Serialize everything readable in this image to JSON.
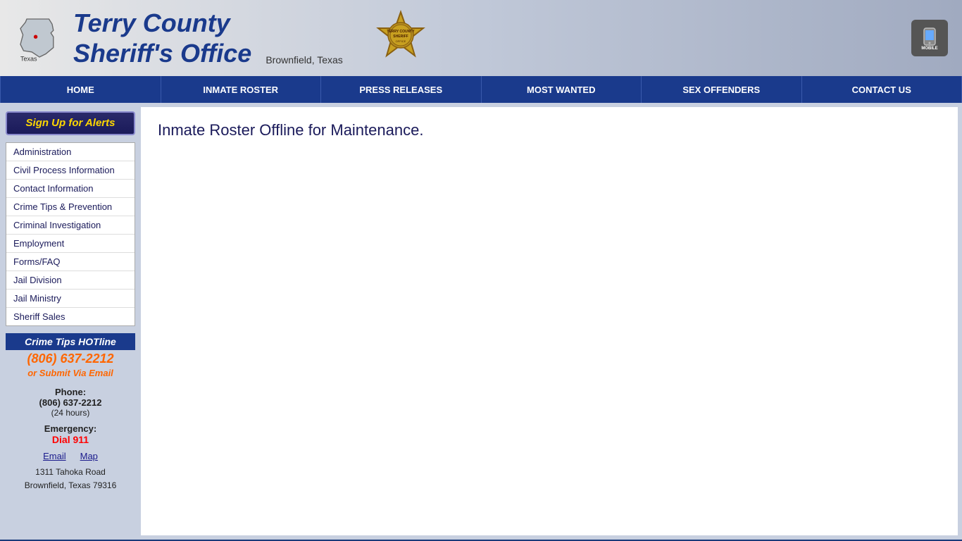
{
  "header": {
    "title_main": "Terry County",
    "title_sub": "Sheriff's Office",
    "location": "Brownfield, Texas",
    "texas_label": "Texas",
    "mobile_label": "MOBILE"
  },
  "nav": {
    "items": [
      {
        "label": "HOME",
        "id": "home"
      },
      {
        "label": "INMATE ROSTER",
        "id": "inmate-roster"
      },
      {
        "label": "PRESS RELEASES",
        "id": "press-releases"
      },
      {
        "label": "MOST WANTED",
        "id": "most-wanted"
      },
      {
        "label": "SEX OFFENDERS",
        "id": "sex-offenders"
      },
      {
        "label": "CONTACT US",
        "id": "contact-us"
      }
    ]
  },
  "sidebar": {
    "sign_up_label": "Sign Up for Alerts",
    "nav_items": [
      {
        "label": "Administration",
        "id": "administration"
      },
      {
        "label": "Civil Process Information",
        "id": "civil-process"
      },
      {
        "label": "Contact Information",
        "id": "contact-info"
      },
      {
        "label": "Crime Tips & Prevention",
        "id": "crime-tips"
      },
      {
        "label": "Criminal Investigation",
        "id": "criminal-investigation"
      },
      {
        "label": "Employment",
        "id": "employment"
      },
      {
        "label": "Forms/FAQ",
        "id": "forms-faq"
      },
      {
        "label": "Jail Division",
        "id": "jail-division"
      },
      {
        "label": "Jail Ministry",
        "id": "jail-ministry"
      },
      {
        "label": "Sheriff Sales",
        "id": "sheriff-sales"
      }
    ],
    "crime_tips_hotline_label": "Crime Tips HOTline",
    "crime_tips_phone": "(806) 637-2212",
    "crime_tips_email_label": "or Submit Via Email",
    "phone_label": "Phone:",
    "phone_number": "(806) 637-2212",
    "phone_hours": "(24 hours)",
    "emergency_label": "Emergency:",
    "dial_911": "Dial 911",
    "link_email": "Email",
    "link_map": "Map",
    "address_line1": "1311 Tahoka Road",
    "address_line2": "Brownfield, Texas 79316"
  },
  "main": {
    "title": "Inmate Roster Offline for Maintenance."
  }
}
